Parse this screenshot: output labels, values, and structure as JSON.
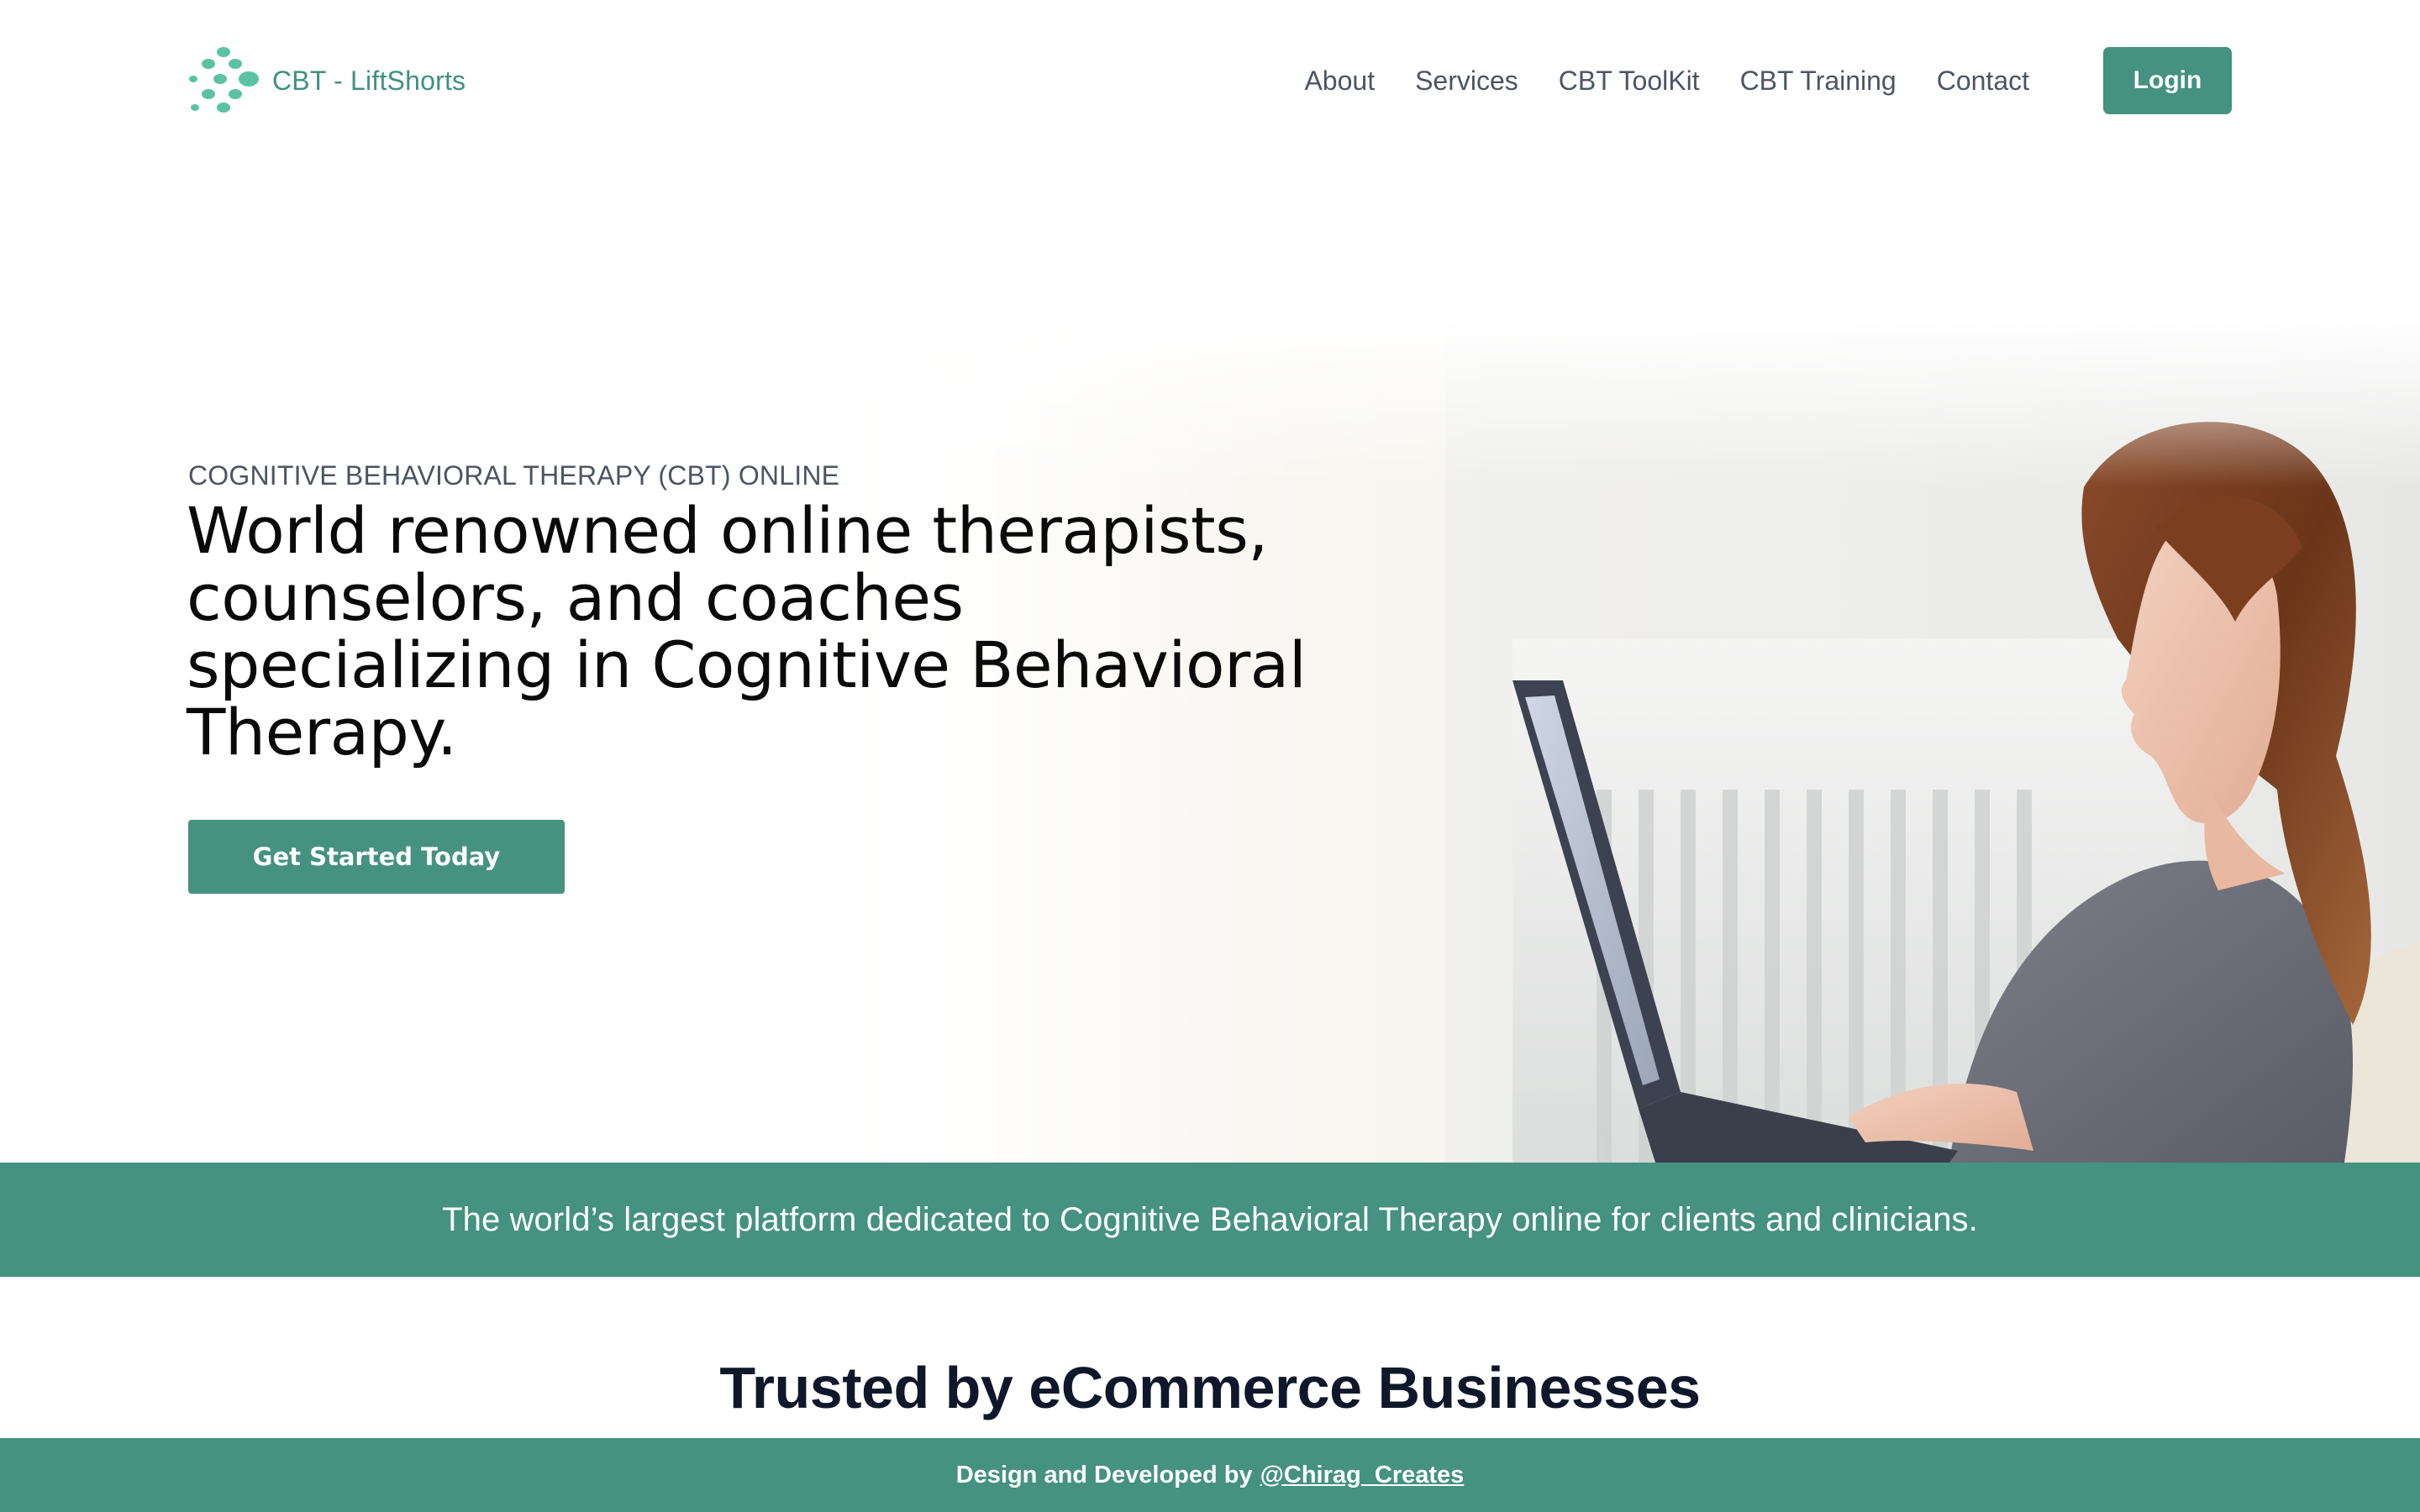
{
  "header": {
    "brand": "CBT - LiftShorts",
    "logo_icon": "dots-logo-icon",
    "brand_color": "#3f9182",
    "nav": [
      {
        "label": "About"
      },
      {
        "label": "Services"
      },
      {
        "label": "CBT ToolKit"
      },
      {
        "label": "CBT Training"
      },
      {
        "label": "Contact"
      }
    ],
    "login_label": "Login"
  },
  "hero": {
    "eyebrow": "COGNITIVE BEHAVIORAL THERAPY (CBT) ONLINE",
    "headline": "World renowned online therapists, counselors, and coaches specializing in Cognitive Behavioral Therapy.",
    "cta_label": "Get Started Today",
    "image": "woman-using-laptop-photo"
  },
  "banner": {
    "text": "The world’s largest platform dedicated to Cognitive Behavioral Therapy online for clients and clinicians."
  },
  "trusted": {
    "heading": "Trusted by eCommerce Businesses"
  },
  "footer": {
    "prefix": "Design and Developed by",
    "link": "@Chirag_Creates"
  },
  "colors": {
    "accent": "#44927f",
    "nav_text": "#4b5563",
    "heading": "#0f172a"
  }
}
